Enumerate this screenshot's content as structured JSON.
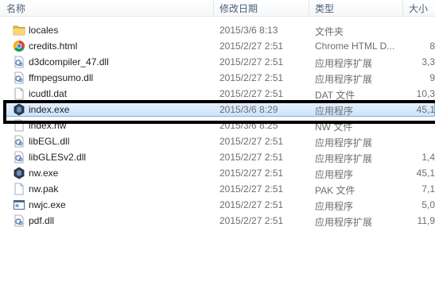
{
  "columns": {
    "name": "名称",
    "date": "修改日期",
    "type": "类型",
    "size": "大小"
  },
  "files": [
    {
      "name": "locales",
      "date": "2015/3/6 8:13",
      "type": "文件夹",
      "size": "",
      "icon": "folder-icon"
    },
    {
      "name": "credits.html",
      "date": "2015/2/27 2:51",
      "type": "Chrome HTML D...",
      "size": "8",
      "icon": "chrome-icon"
    },
    {
      "name": "d3dcompiler_47.dll",
      "date": "2015/2/27 2:51",
      "type": "应用程序扩展",
      "size": "3,3",
      "icon": "dll-icon"
    },
    {
      "name": "ffmpegsumo.dll",
      "date": "2015/2/27 2:51",
      "type": "应用程序扩展",
      "size": "9",
      "icon": "dll-icon"
    },
    {
      "name": "icudtl.dat",
      "date": "2015/2/27 2:51",
      "type": "DAT 文件",
      "size": "10,3",
      "icon": "file-icon"
    },
    {
      "name": "index.exe",
      "date": "2015/3/6 8:29",
      "type": "应用程序",
      "size": "45,1",
      "icon": "exe-icon",
      "selected": true
    },
    {
      "name": "index.nw",
      "date": "2015/3/6 8:25",
      "type": "NW 文件",
      "size": "",
      "icon": "file-icon"
    },
    {
      "name": "libEGL.dll",
      "date": "2015/2/27 2:51",
      "type": "应用程序扩展",
      "size": "",
      "icon": "dll-icon"
    },
    {
      "name": "libGLESv2.dll",
      "date": "2015/2/27 2:51",
      "type": "应用程序扩展",
      "size": "1,4",
      "icon": "dll-icon"
    },
    {
      "name": "nw.exe",
      "date": "2015/2/27 2:51",
      "type": "应用程序",
      "size": "45,1",
      "icon": "exe-icon"
    },
    {
      "name": "nw.pak",
      "date": "2015/2/27 2:51",
      "type": "PAK 文件",
      "size": "7,1",
      "icon": "file-icon"
    },
    {
      "name": "nwjc.exe",
      "date": "2015/2/27 2:51",
      "type": "应用程序",
      "size": "5,0",
      "icon": "app-window-icon"
    },
    {
      "name": "pdf.dll",
      "date": "2015/2/27 2:51",
      "type": "应用程序扩展",
      "size": "11,9",
      "icon": "dll-icon"
    }
  ]
}
